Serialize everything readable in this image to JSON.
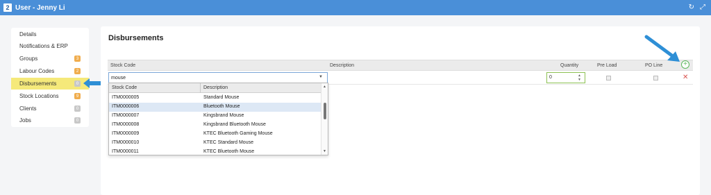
{
  "window": {
    "badge": "2",
    "title": "User - Jenny Li",
    "icons": [
      "refresh-icon",
      "collapse-icon"
    ]
  },
  "sidebar": {
    "items": [
      {
        "label": "Details",
        "badge": null,
        "active": false
      },
      {
        "label": "Notifications & ERP",
        "badge": null,
        "active": false
      },
      {
        "label": "Groups",
        "badge": "3",
        "badge_color": "#f0ad4e",
        "active": false
      },
      {
        "label": "Labour Codes",
        "badge": "2",
        "badge_color": "#f0ad4e",
        "active": false
      },
      {
        "label": "Disbursements",
        "badge": "0",
        "badge_color": "#c8c8c8",
        "active": true
      },
      {
        "label": "Stock Locations",
        "badge": "9",
        "badge_color": "#f0ad4e",
        "active": false
      },
      {
        "label": "Clients",
        "badge": "0",
        "badge_color": "#c8c8c8",
        "active": false
      },
      {
        "label": "Jobs",
        "badge": "0",
        "badge_color": "#c8c8c8",
        "active": false
      }
    ]
  },
  "panel": {
    "title": "Disbursements",
    "columns": {
      "stock_code": "Stock Code",
      "description": "Description",
      "quantity": "Quantity",
      "pre_load": "Pre Load",
      "po_line": "PO Line"
    },
    "row": {
      "stock_code_value": "mouse",
      "quantity_value": "0"
    }
  },
  "dropdown": {
    "headers": [
      "Stock Code",
      "Description"
    ],
    "selected_index": 1,
    "rows": [
      {
        "code": "ITM0000005",
        "description": "Standard Mouse"
      },
      {
        "code": "ITM0000006",
        "description": "Bluetooth Mouse"
      },
      {
        "code": "ITM0000007",
        "description": "Kingsbrand Mouse"
      },
      {
        "code": "ITM0000008",
        "description": "Kingsbrand Bluetooth Mouse"
      },
      {
        "code": "ITM0000009",
        "description": "KTEC Bluetooth Gaming Mouse"
      },
      {
        "code": "ITM0000010",
        "description": "KTEC Standard Mouse"
      },
      {
        "code": "ITM0000011",
        "description": "KTEC Bluetooth Mouse"
      }
    ]
  },
  "colors": {
    "titlebar": "#4a8fd8",
    "active_nav": "#f5e97a",
    "badge_orange": "#f0ad4e",
    "callout_arrow": "#2e8fd6",
    "add_green": "#5cb85c",
    "delete_red": "#d9534f"
  }
}
